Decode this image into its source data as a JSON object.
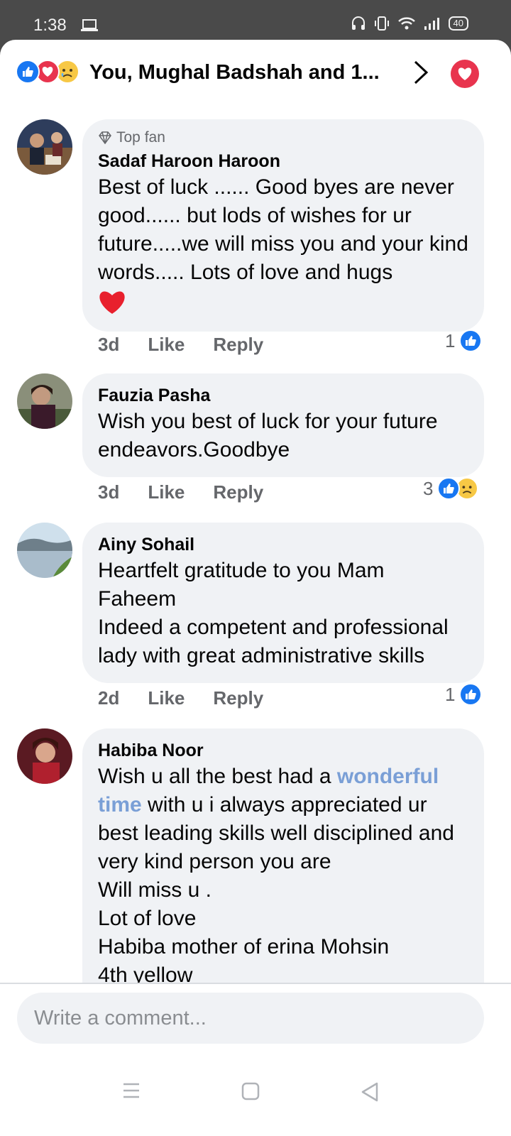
{
  "status": {
    "time": "1:38",
    "battery": "40"
  },
  "header": {
    "title": "You, Mughal Badshah and 1..."
  },
  "comments": [
    {
      "badge": "Top fan",
      "author": "Sadaf Haroon Haroon",
      "text": "Best of luck ...... Good byes are never good...... but lods of wishes for ur future.....we will miss you and your kind words..... Lots of love and hugs",
      "time": "3d",
      "like": "Like",
      "reply": "Reply",
      "reactions": "1"
    },
    {
      "author": "Fauzia Pasha",
      "text": "Wish you best of luck for your future endeavors.Goodbye",
      "time": "3d",
      "like": "Like",
      "reply": "Reply",
      "reactions": "3"
    },
    {
      "author": "Ainy Sohail",
      "text_lines": [
        "Heartfelt gratitude to you Mam",
        "Faheem",
        "Indeed a competent and professional lady with great administrative skills"
      ],
      "time": "2d",
      "like": "Like",
      "reply": "Reply",
      "reactions": "1"
    },
    {
      "author": "Habiba Noor",
      "text_before": "Wish u all the best had a ",
      "text_link": "wonderful time",
      "text_after": " with u i always appreciated ur best leading skills well disciplined and very kind person you are",
      "text_lines": [
        "Will miss u .",
        "Lot of love",
        "Habiba mother of erina Mohsin",
        "4th yellow"
      ]
    }
  ],
  "composer": {
    "placeholder": "Write a comment..."
  },
  "colors": {
    "accent": "#1877f2",
    "heart": "#e8344e",
    "bubble": "#f0f2f5",
    "link": "#7a9fd6"
  }
}
